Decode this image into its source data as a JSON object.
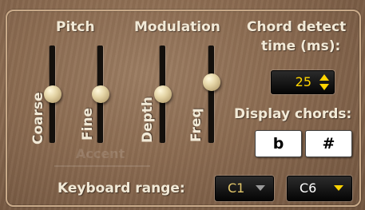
{
  "pitch": {
    "title": "Pitch",
    "sliders": [
      {
        "label": "Coarse",
        "value": 0.5
      },
      {
        "label": "Fine",
        "value": 0.5
      }
    ]
  },
  "modulation": {
    "title": "Modulation",
    "sliders": [
      {
        "label": "Depth",
        "value": 0.5
      },
      {
        "label": "Freq",
        "value": 0.62
      }
    ]
  },
  "chord_detect": {
    "title_line1": "Chord detect",
    "title_line2": "time (ms):",
    "value": "25"
  },
  "display_chords": {
    "title": "Display chords:",
    "flat_label": "b",
    "sharp_label": "#"
  },
  "keyboard_range": {
    "title": "Keyboard range:",
    "low": "C1",
    "high": "C6"
  },
  "colors": {
    "panel_wood": "#8a6a50",
    "label_text": "#f2ead7",
    "display_amber": "#ffd400",
    "dropdown_low_text": "#e3c76a",
    "dropdown_high_text": "#ffffff"
  }
}
